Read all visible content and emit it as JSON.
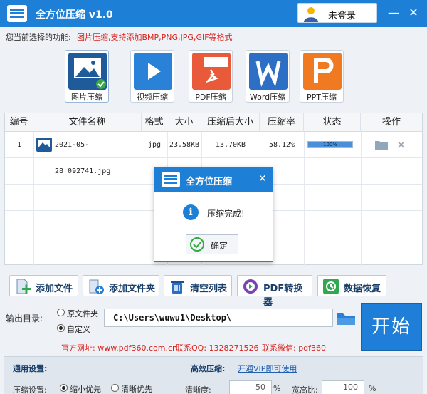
{
  "app": {
    "title": "全方位压缩 v1.0",
    "login_label": "未登录"
  },
  "function_bar": {
    "label": "您当前选择的功能:",
    "description": "图片压缩,支持添加BMP,PNG,JPG,GIF等格式"
  },
  "tiles": [
    {
      "label": "图片压缩",
      "icon": "image-icon",
      "active": true
    },
    {
      "label": "视频压缩",
      "icon": "video-play-icon",
      "active": false
    },
    {
      "label": "PDF压缩",
      "icon": "pdf-file-icon",
      "active": false
    },
    {
      "label": "Word压缩",
      "icon": "word-file-icon",
      "active": false
    },
    {
      "label": "PPT压缩",
      "icon": "ppt-file-icon",
      "active": false
    }
  ],
  "table": {
    "headers": [
      "编号",
      "文件名称",
      "格式",
      "大小",
      "压缩后大小",
      "压缩率",
      "状态",
      "操作"
    ],
    "rows": [
      {
        "index": "1",
        "filename": "2021-05-28_092741.jpg",
        "format": "jpg",
        "size": "23.58KB",
        "compressed_size": "13.70KB",
        "ratio": "58.12%",
        "progress_text": "100%",
        "progress": 1.0
      }
    ]
  },
  "toolbar": {
    "add_file": "添加文件",
    "add_folder": "添加文件夹",
    "clear_list": "清空列表",
    "pdf_converter": "PDF转换器",
    "data_recovery": "数据恢复"
  },
  "output": {
    "label": "输出目录:",
    "option_original": "原文件夹",
    "option_custom": "自定义",
    "selected": "custom",
    "path": "C:\\Users\\wuwu1\\Desktop\\",
    "start_label": "开始"
  },
  "info": {
    "website": "官方网址: www.pdf360.com.cn",
    "qq": "联系QQ: 1328271526",
    "wechat": "联系微信: pdf360"
  },
  "settings": {
    "general_label": "通用设置:",
    "efficient_label": "高效压缩:",
    "vip_link": "开通VIP即可使用",
    "compress_setting_label": "压缩设置:",
    "option_size_first": "缩小优先",
    "option_clarity_first": "清晰优先",
    "clarity_label": "清晰度:",
    "clarity_value": "50",
    "clarity_unit": "%",
    "aspect_label": "宽高比:",
    "aspect_value": "100",
    "aspect_unit": "%"
  },
  "dialog": {
    "title": "全方位压缩",
    "message": "压缩完成!",
    "ok_label": "确定"
  },
  "colors": {
    "primary": "#1e7fd6",
    "accent_red": "#d9221c",
    "button_text": "#1a3f6a"
  }
}
